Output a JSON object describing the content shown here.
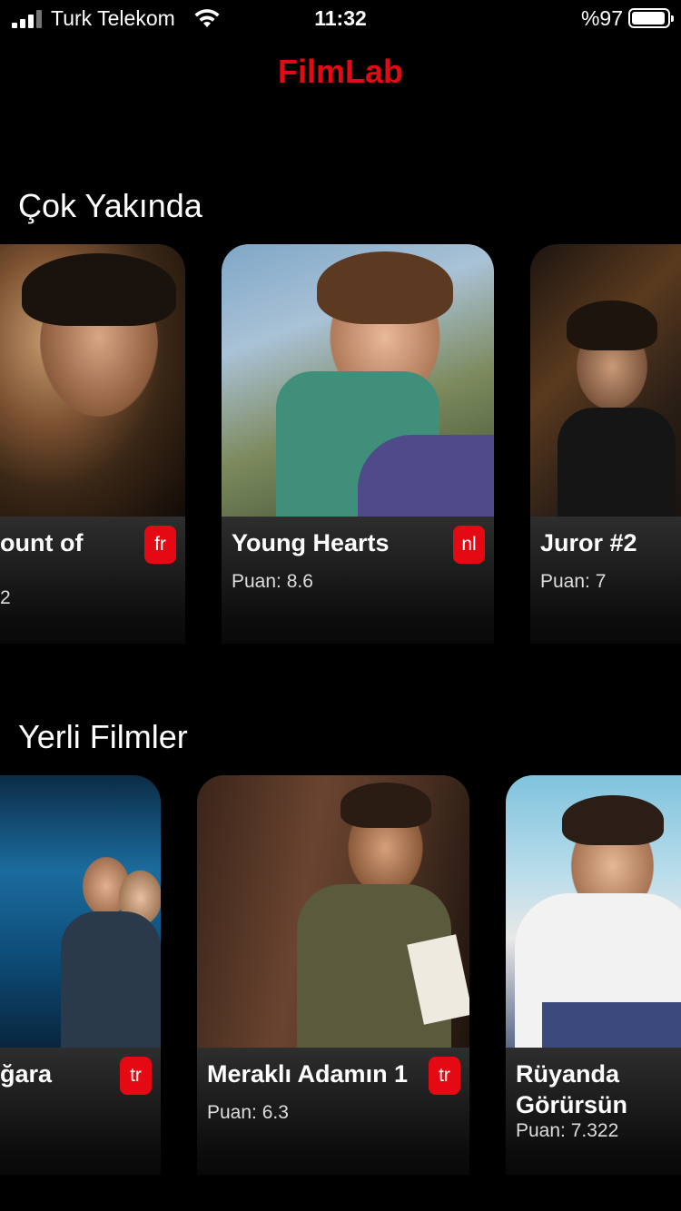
{
  "status_bar": {
    "carrier": "Turk Telekom",
    "time": "11:32",
    "battery": "%97"
  },
  "app": {
    "title": "FilmLab",
    "accent_color": "#e50914"
  },
  "sections": [
    {
      "title": "Çok Yakında",
      "movies": [
        {
          "title": "ount of",
          "score": "2",
          "lang": "fr"
        },
        {
          "title": "Young Hearts",
          "score": "Puan: 8.6",
          "lang": "nl"
        },
        {
          "title": "Juror #2",
          "score": "Puan: 7"
        }
      ]
    },
    {
      "title": "Yerli Filmler",
      "movies": [
        {
          "title": "ğara",
          "lang": "tr"
        },
        {
          "title": "Meraklı Adamın 1",
          "score": "Puan: 6.3",
          "lang": "tr"
        },
        {
          "title": "Rüyanda Görürsün",
          "score": "Puan: 7.322"
        }
      ]
    }
  ],
  "icons": {
    "signal": "cellular-signal-icon",
    "wifi": "wifi-icon",
    "battery": "battery-icon"
  }
}
